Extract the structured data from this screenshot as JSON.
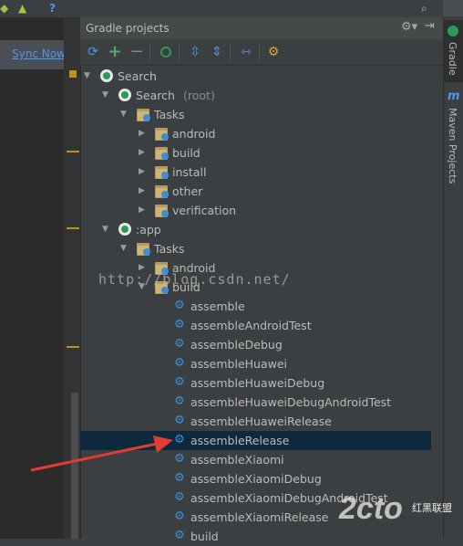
{
  "top_bar": {
    "question_icon_label": "?"
  },
  "editor": {
    "sync_link": "Sync Now"
  },
  "panel": {
    "title": "Gradle projects"
  },
  "right_stripe": {
    "gradle_tab": "Gradle",
    "maven_tab": "Maven Projects",
    "maven_glyph": "m"
  },
  "tree": [
    {
      "label": "Search",
      "sub": ""
    },
    {
      "label": "Search",
      "sub": "(root)"
    },
    {
      "label": "Tasks"
    },
    {
      "label": "android"
    },
    {
      "label": "build"
    },
    {
      "label": "install"
    },
    {
      "label": "other"
    },
    {
      "label": "verification"
    },
    {
      "label": ":app"
    },
    {
      "label": "Tasks"
    },
    {
      "label": "android"
    },
    {
      "label": "build"
    },
    {
      "label": "assemble"
    },
    {
      "label": "assembleAndroidTest"
    },
    {
      "label": "assembleDebug"
    },
    {
      "label": "assembleHuawei"
    },
    {
      "label": "assembleHuaweiDebug"
    },
    {
      "label": "assembleHuaweiDebugAndroidTest"
    },
    {
      "label": "assembleHuaweiRelease"
    },
    {
      "label": "assembleRelease"
    },
    {
      "label": "assembleXiaomi"
    },
    {
      "label": "assembleXiaomiDebug"
    },
    {
      "label": "assembleXiaomiDebugAndroidTest"
    },
    {
      "label": "assembleXiaomiRelease"
    },
    {
      "label": "build"
    }
  ],
  "watermark": {
    "url": "http://blog.csdn.net/",
    "logo": "2cto",
    "logo_sub": "红黑联盟"
  },
  "colors": {
    "selection": "#0d293e",
    "link": "#5394ec",
    "arrow": "#e03c33"
  }
}
